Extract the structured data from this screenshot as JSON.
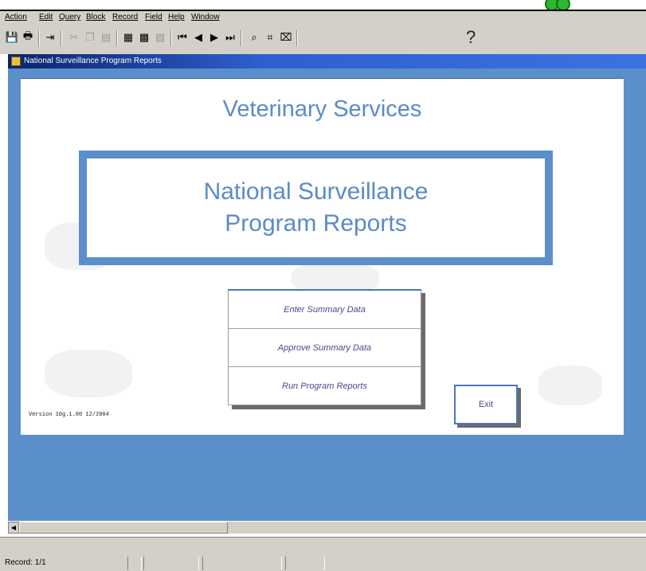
{
  "menu": {
    "items": [
      "Action",
      "Edit",
      "Query",
      "Block",
      "Record",
      "Field",
      "Help",
      "Window"
    ]
  },
  "toolbar": {
    "icons": [
      "save-icon",
      "print-icon",
      "exit-icon",
      "cut-icon",
      "copy-icon",
      "paste-icon",
      "insert-record-icon",
      "duplicate-record-icon",
      "delete-record-icon",
      "first-record-icon",
      "previous-record-icon",
      "next-record-icon",
      "last-record-icon",
      "enter-query-icon",
      "execute-query-icon",
      "cancel-query-icon",
      "help-icon"
    ],
    "help_glyph": "?"
  },
  "form": {
    "title": "National Surveillance Program Reports",
    "header": "Veterinary Services",
    "program_title_line1": "National Surveillance",
    "program_title_line2": "Program Reports",
    "buttons": {
      "enter": "Enter Summary Data",
      "approve": "Approve Summary Data",
      "run": "Run Program Reports",
      "exit": "Exit"
    },
    "version": "Version 10g.1.00 12/2004"
  },
  "status": {
    "record": "Record: 1/1"
  },
  "colors": {
    "form_background": "#5b8fcb",
    "title_text": "#5a8bc8",
    "titlebar": "#0a246a",
    "toolbar": "#d4d0c8"
  }
}
